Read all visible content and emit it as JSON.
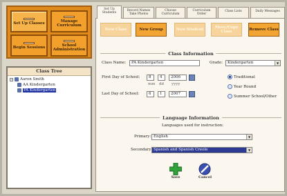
{
  "tiles": [
    {
      "label": "Set Up Classes"
    },
    {
      "label": "Manage Curriculum"
    },
    {
      "label": "Begin Sessions"
    },
    {
      "label": "School Administration"
    }
  ],
  "tree": {
    "title": "Class Tree",
    "items": [
      {
        "label": "Aaron Smith"
      },
      {
        "label": "AA Kindergarten"
      },
      {
        "label": "PA Kindergarten"
      }
    ]
  },
  "tabs": [
    {
      "label": "Set Up Students"
    },
    {
      "label": "Record Names Take Photos"
    },
    {
      "label": "Choose Curriculum"
    },
    {
      "label": "Curriculum Order"
    },
    {
      "label": "Class Lists"
    },
    {
      "label": "Daily Messages"
    }
  ],
  "toolbar": {
    "new_class": "New Class",
    "new_group": "New Group",
    "new_student": "New Student",
    "move_copy": "Move/Copy Class",
    "remove_class": "Remove Class"
  },
  "class_info": {
    "title": "Class Information",
    "class_name_label": "Class Name:",
    "class_name_value": "PA Kindergarten",
    "grade_label": "Grade:",
    "grade_value": "Kindergarten",
    "first_day_label": "First Day of School:",
    "first_day": {
      "m": "8",
      "d": "4",
      "y": "2006"
    },
    "date_hint": {
      "m": "mm",
      "d": "dd",
      "y": "yyyy"
    },
    "last_day_label": "Last Day of School:",
    "last_day": {
      "m": "6",
      "d": "1",
      "y": "2007"
    },
    "radios": [
      {
        "label": "Traditional",
        "checked": true
      },
      {
        "label": "Year Round",
        "checked": false
      },
      {
        "label": "Summer School/Other",
        "checked": false
      }
    ]
  },
  "language_info": {
    "title": "Language Information",
    "subtitle": "Languages used for instruction:",
    "primary_label": "Primary:",
    "primary_value": "English",
    "secondary_label": "Secondary:",
    "secondary_value": "Spanish and Spanish Creole"
  },
  "actions": {
    "save": "Save",
    "cancel": "Cancel"
  },
  "colors": {
    "accent_orange": "#f3a534",
    "selection_blue": "#1b2fa3",
    "save_green": "#2fa23a",
    "cancel_blue": "#3b4fb0"
  }
}
